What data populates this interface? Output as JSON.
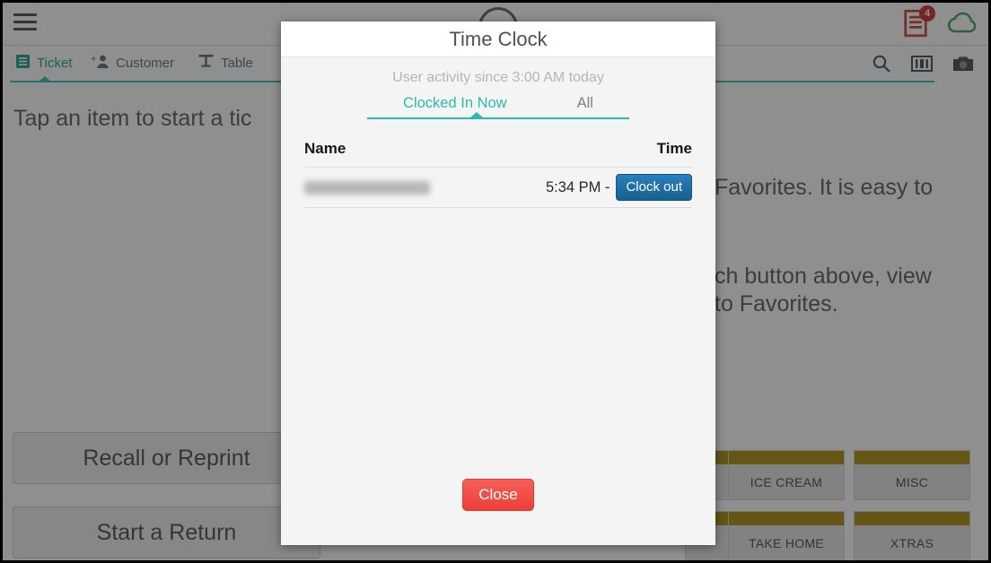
{
  "app": {
    "menu_icon": "hamburger-menu-icon",
    "topbar_icons": [
      {
        "name": "receipt-icon",
        "badge": "4"
      },
      {
        "name": "cloud-sync-icon",
        "badge": ""
      }
    ],
    "tabs": [
      {
        "label": "Ticket",
        "icon": "ticket-list-icon",
        "active": true
      },
      {
        "label": "Customer",
        "icon": "add-customer-icon",
        "active": false
      },
      {
        "label": "Table",
        "icon": "table-icon",
        "active": false
      }
    ],
    "tools": [
      {
        "name": "search-icon"
      },
      {
        "name": "barcode-icon"
      },
      {
        "name": "camera-icon"
      }
    ],
    "hint_line_1": "Tap an item to start a tic",
    "hint_line_2": "Favorites. It is easy to",
    "hint_line_3": "ch button above, view",
    "hint_line_4": "to Favorites.",
    "left_buttons": [
      {
        "label": "Recall or Reprint"
      },
      {
        "label": "Start a Return"
      }
    ],
    "categories": [
      {
        "label": "ICE CREAM"
      },
      {
        "label": "MISC"
      },
      {
        "label": "TAKE HOME"
      },
      {
        "label": "XTRAS"
      }
    ],
    "colors": {
      "accent_teal": "#2bbbad",
      "category_bar": "#a68800",
      "badge_red": "#cc2127",
      "cloud_green": "#2e9e4f"
    }
  },
  "modal": {
    "title": "Time Clock",
    "subtitle": "User activity since 3:00 AM today",
    "tabs": [
      {
        "label": "Clocked In Now",
        "active": true
      },
      {
        "label": "All",
        "active": false
      }
    ],
    "table": {
      "headers": [
        "Name",
        "Time"
      ],
      "rows": [
        {
          "name": "",
          "name_redacted": true,
          "time": "5:34 PM -",
          "action_label": "Clock out"
        }
      ]
    },
    "close_label": "Close"
  }
}
